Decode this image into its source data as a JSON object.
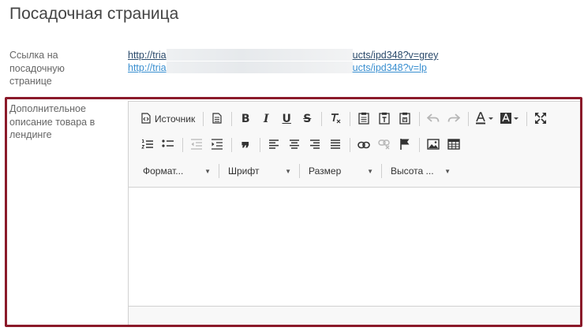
{
  "page": {
    "title": "Посадочная страница"
  },
  "landing_link": {
    "label_lines": [
      "Ссылка на",
      "посадочную",
      "странице"
    ],
    "url1_start": "http://tria",
    "url1_end": "ucts/ipd348?v=grey",
    "url2_start": "http://tria",
    "url2_end": "ucts/ipd348?v=lp"
  },
  "description": {
    "label_lines": [
      "Дополнительное",
      "описание товара в",
      "лендинге"
    ]
  },
  "editor": {
    "source_label": "Источник",
    "combos": {
      "format": "Формат...",
      "font": "Шрифт",
      "size": "Размер",
      "height": "Высота ..."
    },
    "icons": {
      "bold": "B",
      "italic": "I",
      "underline": "U",
      "strike": "S",
      "quote": "❞"
    }
  },
  "colors": {
    "highlight": "#8b1a2a",
    "link_dark": "#2a4a6b",
    "link_light": "#3a8fd0",
    "toolbar_bg": "#f8f8f8"
  }
}
